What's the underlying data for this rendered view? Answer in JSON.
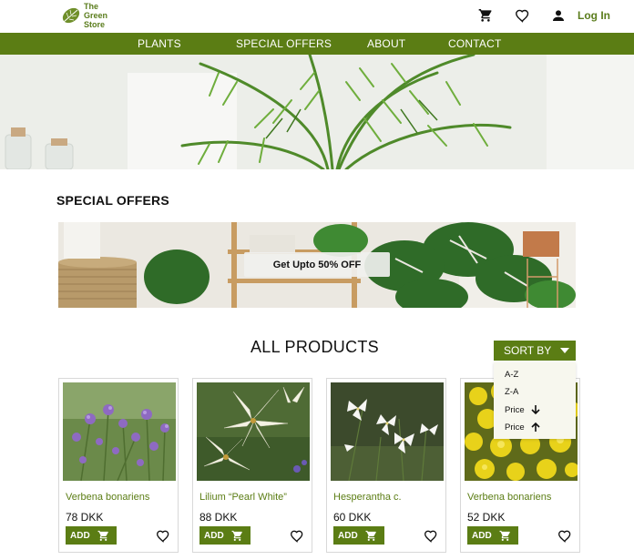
{
  "header": {
    "logo_lines": [
      "The",
      "Green",
      "Store"
    ],
    "login_label": "Log In",
    "icons": [
      "cart-icon",
      "heart-icon",
      "user-icon"
    ]
  },
  "nav": {
    "items": [
      "PLANTS",
      "SPECIAL OFFERS",
      "ABOUT",
      "CONTACT"
    ]
  },
  "special_offers": {
    "title": "SPECIAL OFFERS",
    "banner_label": "Get Upto 50% OFF"
  },
  "products": {
    "title": "ALL PRODUCTS",
    "sort_label": "SORT BY",
    "sort_options": [
      "A-Z",
      "Z-A",
      "Price",
      "Price"
    ],
    "sort_option_icons": [
      "",
      "",
      "arrow-down-icon",
      "arrow-up-icon"
    ],
    "add_label": "ADD",
    "items": [
      {
        "name": "Verbena bonariens",
        "price": "78 DKK"
      },
      {
        "name": "Lilium “Pearl White”",
        "price": "88 DKK"
      },
      {
        "name": "Hesperantha  c.",
        "price": "60 DKK"
      },
      {
        "name": "Verbena bonariens",
        "price": "52 DKK"
      }
    ]
  },
  "colors": {
    "brand_green": "#5b7d14",
    "background": "#ffffff",
    "sort_menu_bg": "#f7f7ee"
  }
}
